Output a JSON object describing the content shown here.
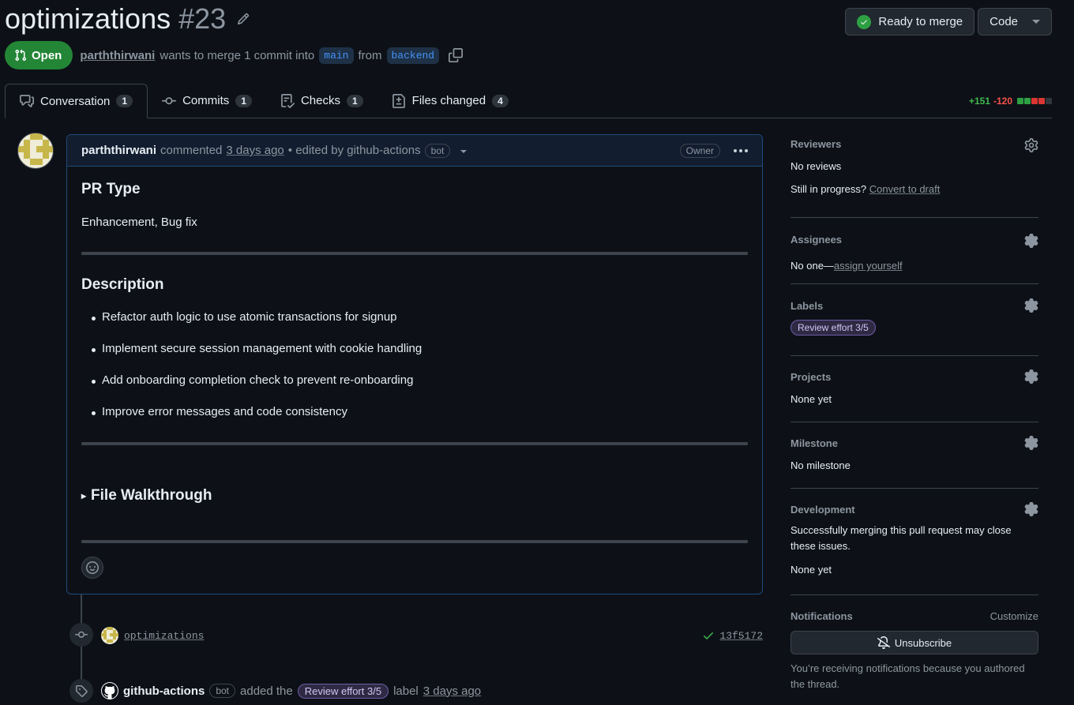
{
  "header": {
    "title": "optimizations",
    "number": "#23",
    "ready_label": "Ready to merge",
    "code_label": "Code"
  },
  "meta": {
    "status": "Open",
    "author": "parththirwani",
    "text1": "wants to merge 1 commit into",
    "base_branch": "main",
    "text2": "from",
    "head_branch": "backend"
  },
  "tabs": [
    {
      "label": "Conversation",
      "count": "1",
      "icon": "comment-discussion-icon"
    },
    {
      "label": "Commits",
      "count": "1",
      "icon": "git-commit-icon"
    },
    {
      "label": "Checks",
      "count": "1",
      "icon": "checklist-icon"
    },
    {
      "label": "Files changed",
      "count": "4",
      "icon": "file-diff-icon"
    }
  ],
  "diffstat": {
    "additions": "+151",
    "deletions": "-120",
    "blocks": [
      "#2ea043",
      "#2ea043",
      "#da3633",
      "#da3633",
      "#30363d"
    ]
  },
  "comment": {
    "author": "parththirwani",
    "action": "commented",
    "time": "3 days ago",
    "edited": "• edited by github-actions",
    "bot_badge": "bot",
    "owner_badge": "Owner",
    "pr_type_heading": "PR Type",
    "pr_type_text": "Enhancement, Bug fix",
    "description_heading": "Description",
    "bullets": [
      "Refactor auth logic to use atomic transactions for signup",
      "Implement secure session management with cookie handling",
      "Add onboarding completion check to prevent re-onboarding",
      "Improve error messages and code consistency"
    ],
    "walkthrough_label": "File Walkthrough"
  },
  "timeline": {
    "commit_message": "optimizations",
    "commit_sha": "13f5172",
    "label_actor": "github-actions",
    "label_bot": "bot",
    "label_text1": "added the",
    "label_name": "Review effort 3/5",
    "label_text2": "label",
    "label_time": "3 days ago"
  },
  "sidebar": {
    "reviewers_title": "Reviewers",
    "reviewers_value": "No reviews",
    "still_text": "Still in progress?",
    "convert_link": "Convert to draft",
    "assignees_title": "Assignees",
    "assignees_value": "No one—",
    "assign_link": "assign yourself",
    "labels_title": "Labels",
    "label_pill": "Review effort 3/5",
    "projects_title": "Projects",
    "projects_value": "None yet",
    "milestone_title": "Milestone",
    "milestone_value": "No milestone",
    "development_title": "Development",
    "development_text": "Successfully merging this pull request may close these issues.",
    "development_value": "None yet",
    "notifications_title": "Notifications",
    "customize_link": "Customize",
    "unsubscribe_label": "Unsubscribe",
    "notif_text": "You’re receiving notifications because you authored the thread."
  },
  "colors": {
    "background": "#0d1117",
    "open_green": "#238636",
    "link_blue": "#4493f8",
    "label_purple": "#6e5ba8"
  }
}
